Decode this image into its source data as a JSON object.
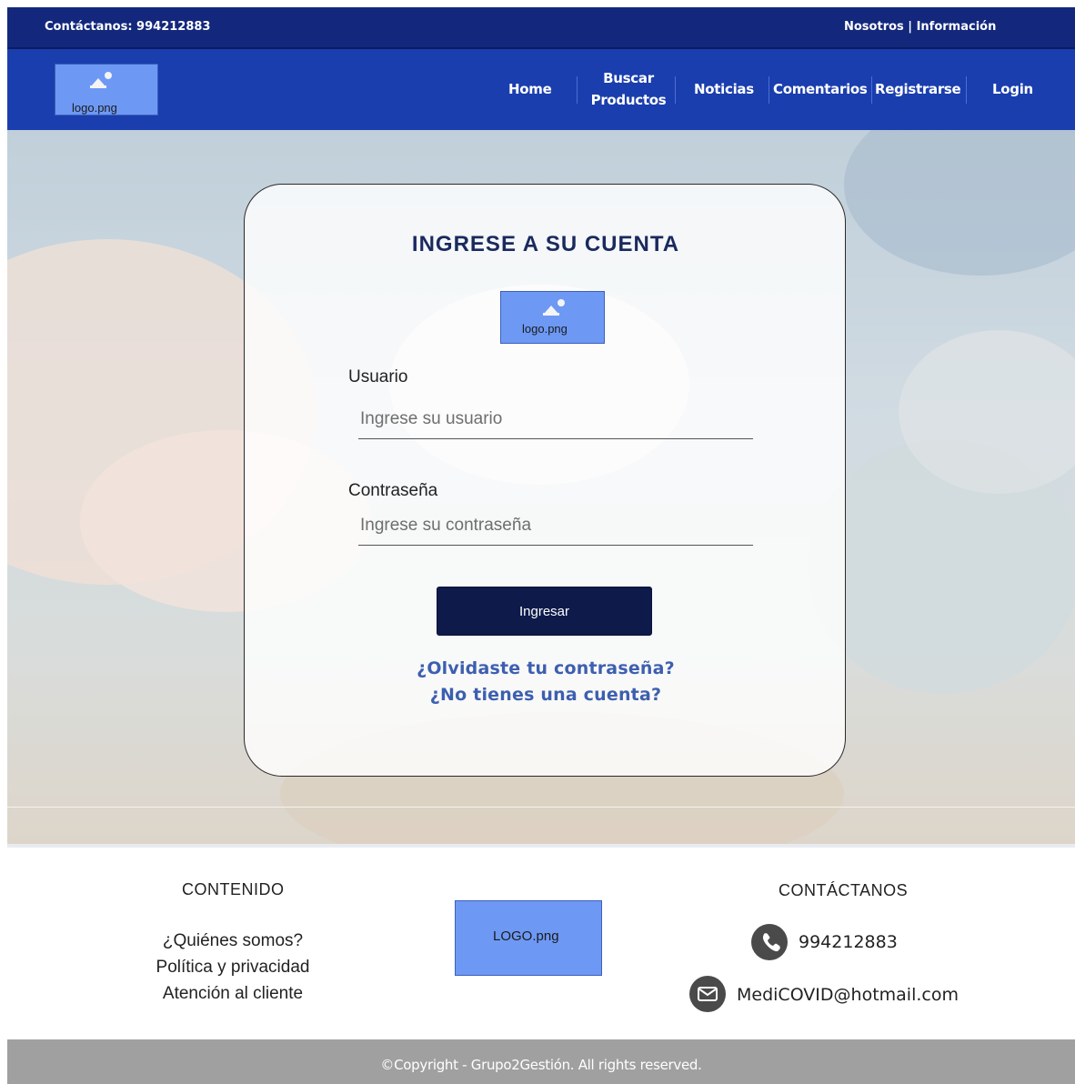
{
  "topbar": {
    "contact": "Contáctanos: 994212883",
    "links": "Nosotros | Información"
  },
  "header": {
    "logo_caption": "logo.png",
    "nav": {
      "home": "Home",
      "buscar_line1": "Buscar",
      "buscar_line2": "Productos",
      "noticias": "Noticias",
      "comentarios": "Comentarios",
      "registrarse": "Registrarse",
      "login": "Login"
    }
  },
  "login": {
    "title": "INGRESE A SU CUENTA",
    "logo_caption": "logo.png",
    "username_label": "Usuario",
    "username_placeholder": "Ingrese su usuario",
    "password_label": "Contraseña",
    "password_placeholder": "Ingrese su contraseña",
    "submit": "Ingresar",
    "forgot": "¿Olvidaste tu contraseña?",
    "no_account": "¿No tienes una cuenta?"
  },
  "footer": {
    "contenido": {
      "title": "CONTENIDO",
      "links": [
        "¿Quiénes somos?",
        "Política y privacidad",
        "Atención al cliente"
      ]
    },
    "logo_caption": "LOGO.png",
    "contacto": {
      "title": "CONTÁCTANOS",
      "phone": "994212883",
      "email": "MediCOVID@hotmail.com"
    },
    "copyright": "©Copyright - Grupo2Gestión. All rights reserved."
  },
  "icons": {
    "image_placeholder": "image-placeholder-icon",
    "phone": "phone-icon",
    "mail": "mail-icon"
  },
  "colors": {
    "topbar": "#13287c",
    "navbar": "#1a3eae",
    "button": "#0e1a4a",
    "link": "#3d5fb0",
    "logo_box": "#6d99f5",
    "bottombar": "#a0a0a0"
  }
}
